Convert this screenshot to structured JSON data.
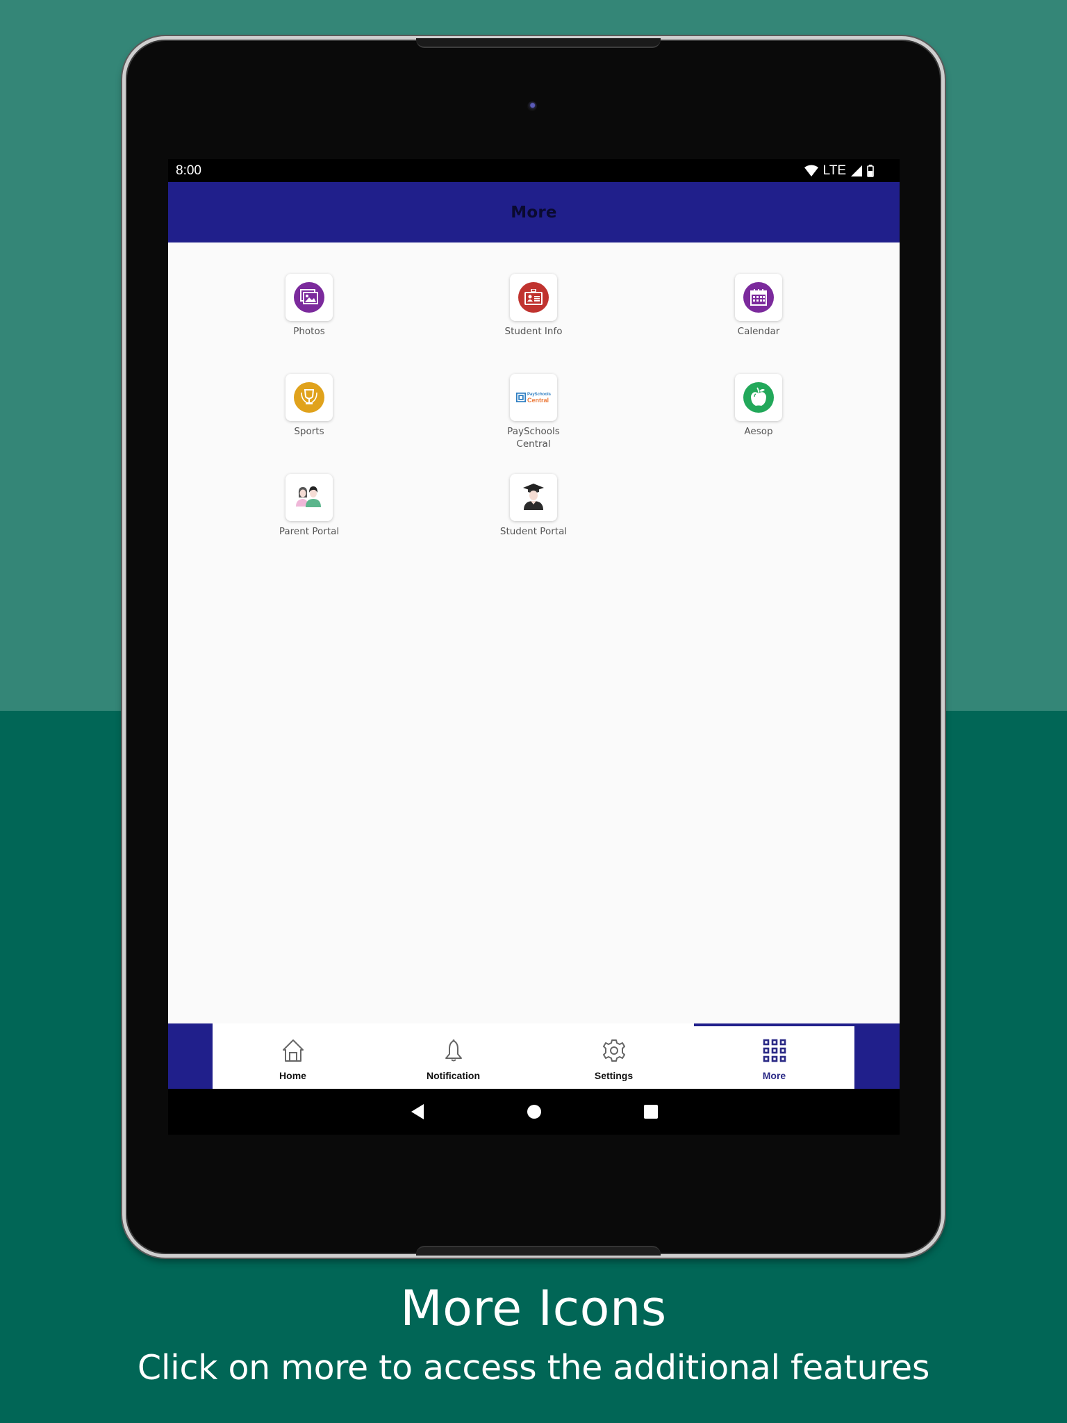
{
  "status_bar": {
    "time": "8:00",
    "network": "LTE",
    "icons": [
      "wifi-icon",
      "cell-signal-icon",
      "battery-icon"
    ]
  },
  "app_bar": {
    "title": "More"
  },
  "tiles": [
    {
      "label": "Photos",
      "icon": "photos-icon",
      "color": "#7b2a9c"
    },
    {
      "label": "Student Info",
      "icon": "id-card-icon",
      "color": "#c0332f"
    },
    {
      "label": "Calendar",
      "icon": "calendar-icon",
      "color": "#7b2a9c"
    },
    {
      "label": "Sports",
      "icon": "trophy-icon",
      "color": "#e0a21c"
    },
    {
      "label": "PaySchools Central",
      "icon": "payschools-logo",
      "logo_text_top": "PaySchools",
      "logo_text_bottom": "Central"
    },
    {
      "label": "Aesop",
      "icon": "apple-icon",
      "color": "#22a85a"
    },
    {
      "label": "Parent Portal",
      "icon": "parents-icon"
    },
    {
      "label": "Student Portal",
      "icon": "graduate-icon"
    }
  ],
  "bottom_nav": {
    "items": [
      {
        "label": "Home",
        "icon": "home-icon",
        "active": false
      },
      {
        "label": "Notification",
        "icon": "bell-icon",
        "active": false
      },
      {
        "label": "Settings",
        "icon": "gear-icon",
        "active": false
      },
      {
        "label": "More",
        "icon": "grid-icon",
        "active": true
      }
    ]
  },
  "system_nav": {
    "buttons": [
      "back-icon",
      "home-circle-icon",
      "recents-icon"
    ]
  },
  "colors": {
    "primary": "#201f8b",
    "bg_top": "#348677",
    "bg_bottom": "#016656"
  },
  "caption": {
    "title": "More Icons",
    "subtitle": "Click on more to access the additional features"
  }
}
